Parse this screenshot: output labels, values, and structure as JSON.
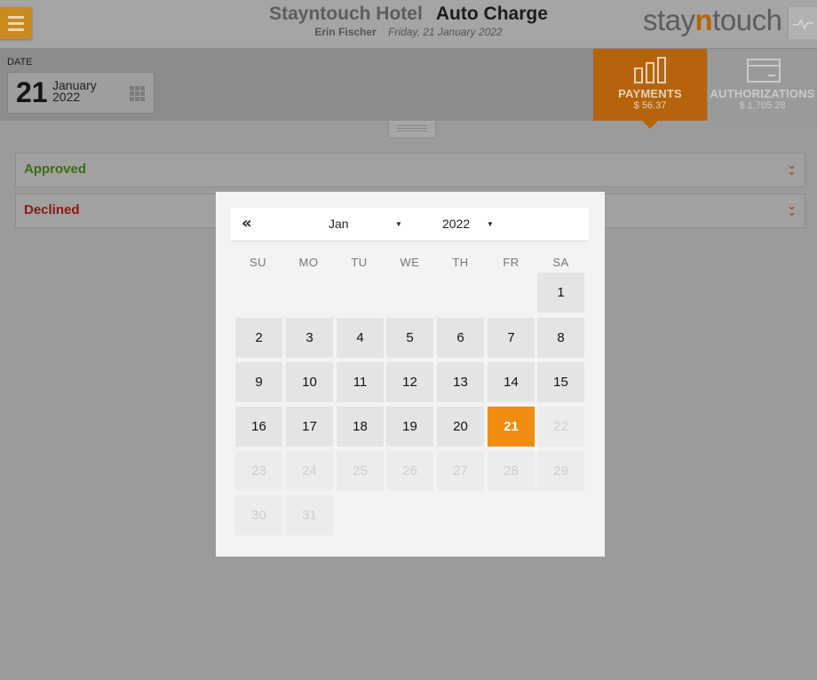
{
  "header": {
    "hotel_name": "Stayntouch Hotel",
    "page_title": "Auto Charge",
    "user_name": "Erin Fischer",
    "business_date": "Friday, 21 January 2022",
    "logo": {
      "pre": "stay",
      "mid": "n",
      "post": "touch"
    }
  },
  "datebar": {
    "label": "DATE",
    "day": "21",
    "month": "January",
    "year": "2022"
  },
  "tabs": {
    "payments": {
      "label": "PAYMENTS",
      "amount": "$ 56.37"
    },
    "authorizations": {
      "label": "AUTHORIZATIONS",
      "amount": "$ 1,705.28"
    }
  },
  "accordions": {
    "approved": "Approved",
    "declined": "Declined"
  },
  "calendar": {
    "prev_icon": "«",
    "month": "Jan",
    "year": "2022",
    "caret": "▼",
    "weekdays": [
      "SU",
      "MO",
      "TU",
      "WE",
      "TH",
      "FR",
      "SA"
    ],
    "selected_day": 21,
    "days": [
      "1",
      "2",
      "3",
      "4",
      "5",
      "6",
      "7",
      "8",
      "9",
      "10",
      "11",
      "12",
      "13",
      "14",
      "15",
      "16",
      "17",
      "18",
      "19",
      "20",
      "21",
      "22",
      "23",
      "24",
      "25",
      "26",
      "27",
      "28",
      "29",
      "30",
      "31"
    ]
  },
  "colors": {
    "accent": "#f08c12",
    "approved": "#3c6b14",
    "declined": "#8a1a12"
  }
}
